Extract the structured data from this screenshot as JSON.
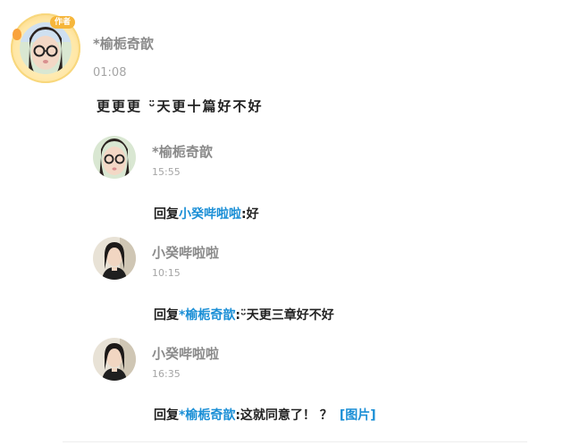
{
  "main_comment": {
    "author_badge": "作者",
    "username": "*榆栀奇歆",
    "time": "01:08",
    "text": "更更更 ᵕ̈天更十篇好不好"
  },
  "replies": [
    {
      "username": "*榆栀奇歆",
      "time": "15:55",
      "prefix": "回复",
      "mention": "小癸哔啦啦",
      "body": ":好",
      "image_link": ""
    },
    {
      "username": "小癸哔啦啦",
      "time": "10:15",
      "prefix": "回复",
      "mention": "*榆栀奇歆",
      "body": ":ᵕ̈天更三章好不好",
      "image_link": ""
    },
    {
      "username": "小癸哔啦啦",
      "time": "16:35",
      "prefix": "回复",
      "mention": "*榆栀奇歆",
      "body": ":这就同意了！ ？",
      "image_link": "[图片]"
    }
  ],
  "colors": {
    "mention": "#1b8fd6",
    "username": "#8a8a8a",
    "time": "#a5a5a5",
    "text": "#222222",
    "badge": "#f6b63b"
  }
}
